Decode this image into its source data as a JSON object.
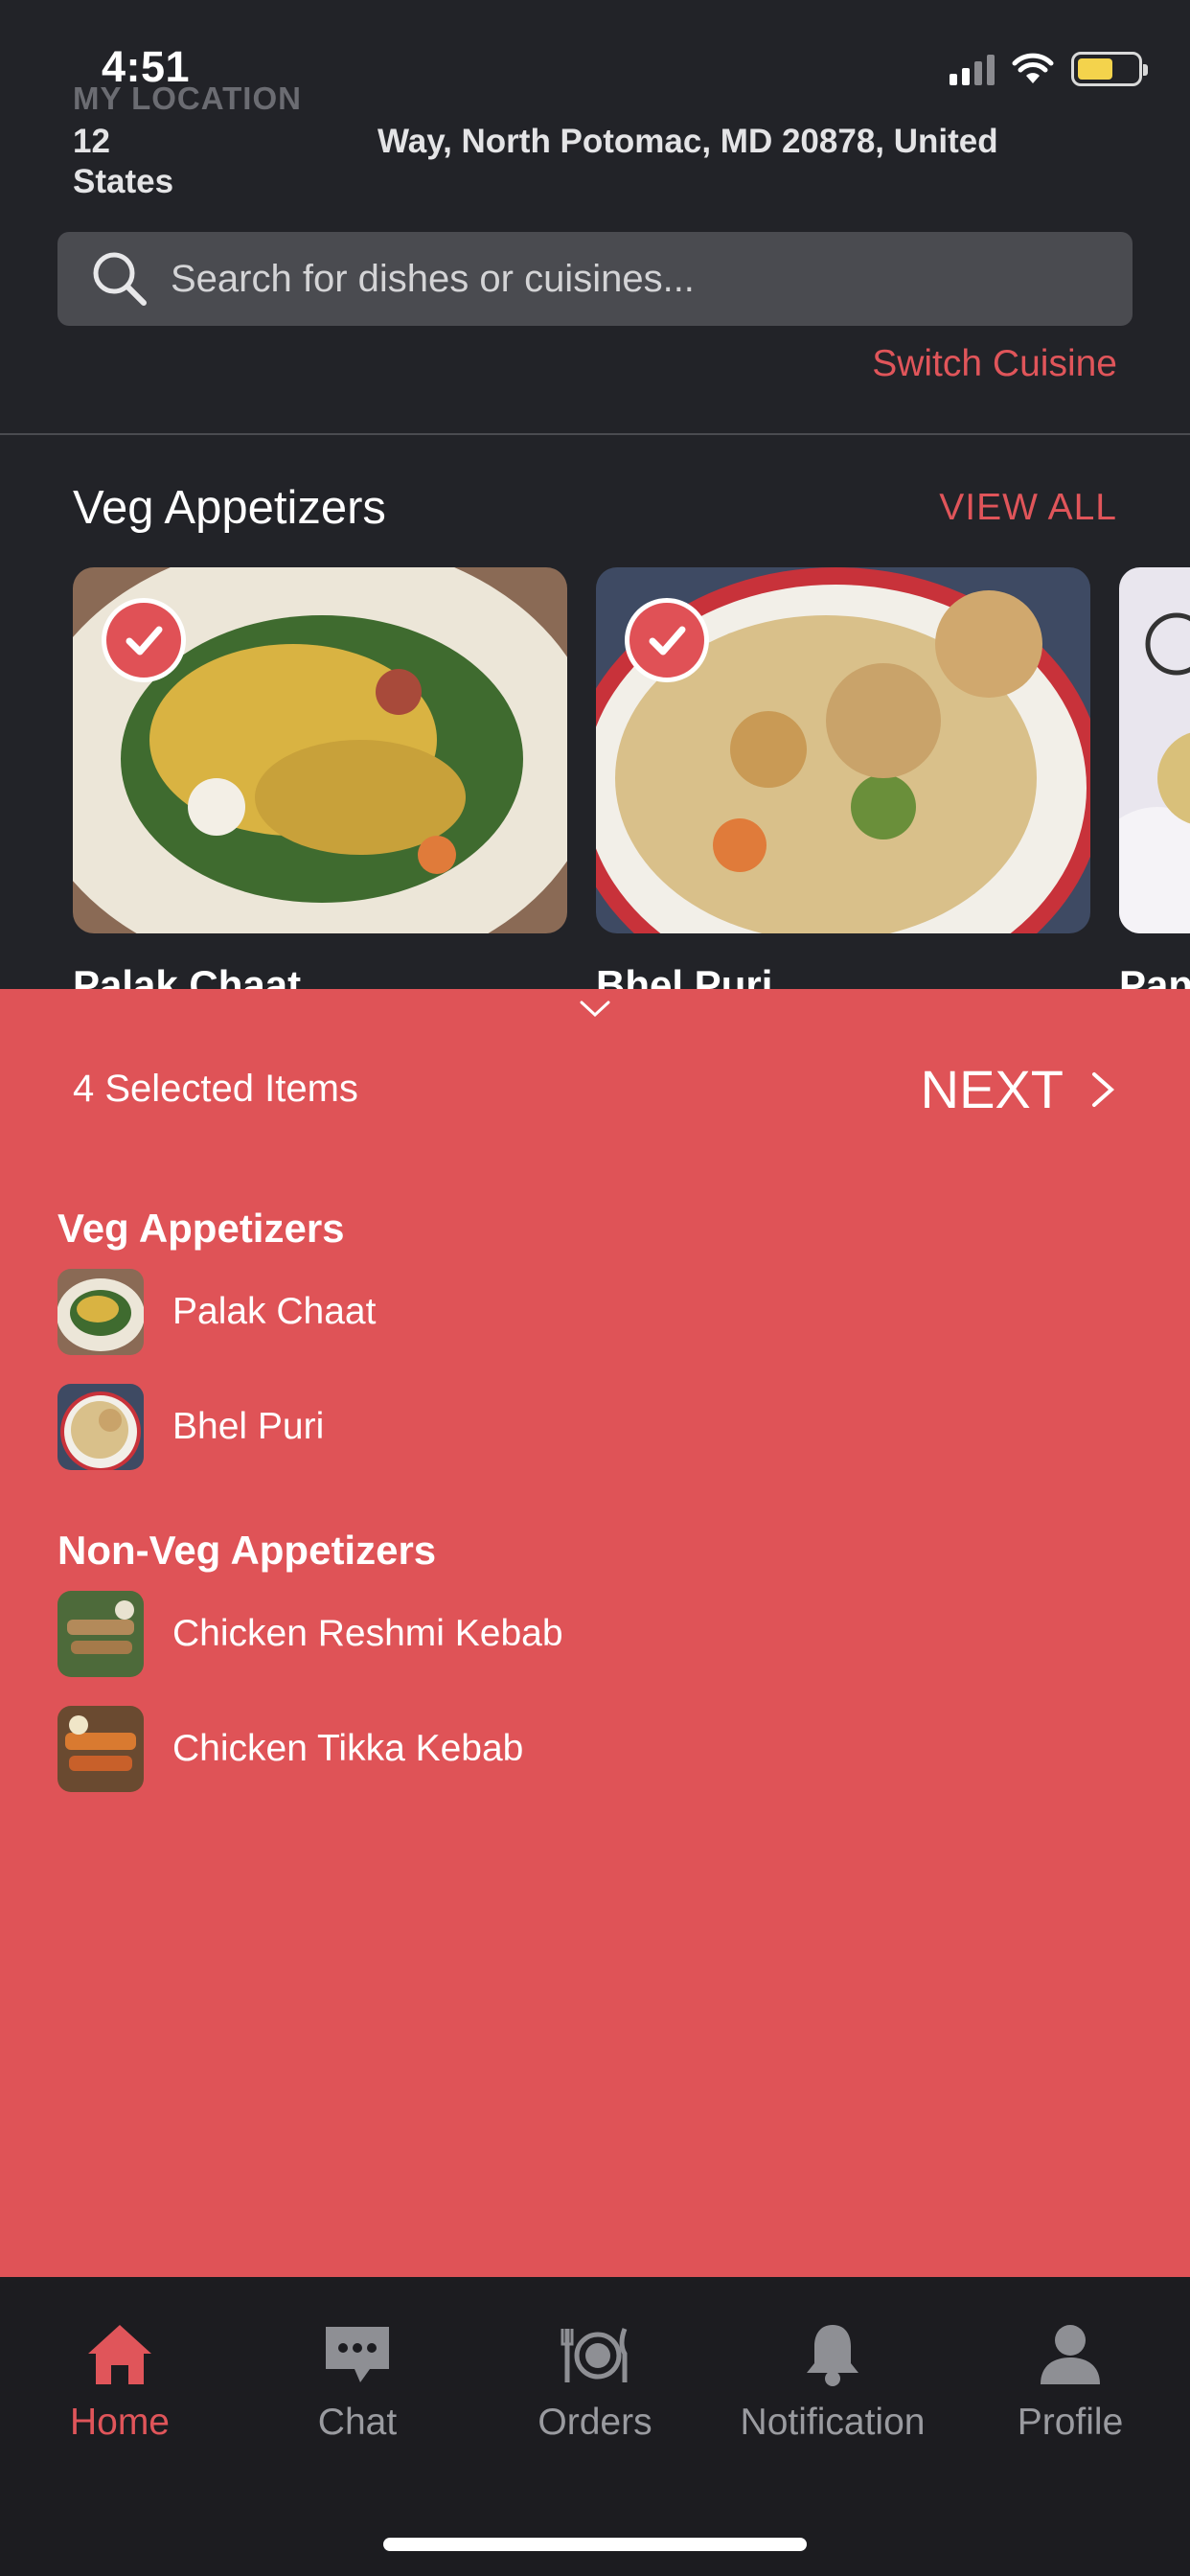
{
  "status": {
    "time": "4:51"
  },
  "location": {
    "label": "MY LOCATION",
    "line1_start": "12",
    "line1_rest": "Way, North Potomac, MD  20878, United",
    "line2": "States"
  },
  "search": {
    "placeholder": "Search for dishes or cuisines..."
  },
  "switch_cuisine": "Switch Cuisine",
  "section": {
    "title": "Veg Appetizers",
    "view_all": "VIEW ALL",
    "cards": [
      {
        "name": "Palak Chaat"
      },
      {
        "name": "Bhel Puri"
      },
      {
        "name": "Pan"
      }
    ]
  },
  "sheet": {
    "selected_count": "4 Selected Items",
    "next_label": "NEXT",
    "groups": [
      {
        "title": "Veg Appetizers",
        "items": [
          "Palak Chaat",
          "Bhel Puri"
        ]
      },
      {
        "title": "Non-Veg Appetizers",
        "items": [
          "Chicken Reshmi Kebab",
          "Chicken Tikka Kebab"
        ]
      }
    ]
  },
  "tabs": [
    {
      "label": "Home",
      "icon": "home-icon",
      "active": true
    },
    {
      "label": "Chat",
      "icon": "chat-icon",
      "active": false
    },
    {
      "label": "Orders",
      "icon": "orders-icon",
      "active": false
    },
    {
      "label": "Notification",
      "icon": "bell-icon",
      "active": false
    },
    {
      "label": "Profile",
      "icon": "profile-icon",
      "active": false
    }
  ],
  "colors": {
    "accent": "#e0555a",
    "sheet": "#df5357",
    "background": "#222328"
  }
}
